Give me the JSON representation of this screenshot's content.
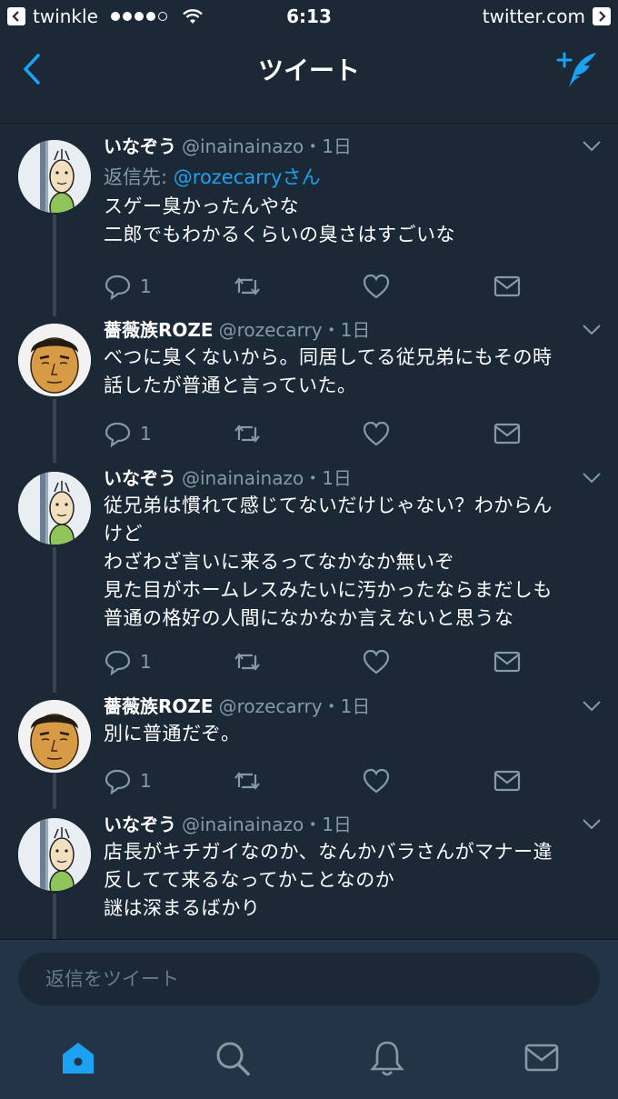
{
  "status_bar": {
    "back_app": "twinkle",
    "time": "6:13",
    "url": "twitter.com"
  },
  "nav": {
    "title": "ツイート"
  },
  "colors": {
    "accent": "#1da1f2",
    "background": "#1b2836",
    "muted": "#8899a6"
  },
  "tweets": [
    {
      "name": "いなぞう",
      "handle": "@inainainazo",
      "time": "・1日",
      "reply_prefix": "返信先: ",
      "reply_mention": "@rozecarryさん",
      "text": "スゲー臭かったんやな\n二郎でもわかるくらいの臭さはすごいな",
      "reply_count": "1",
      "avatar": "avatar-inainainazo"
    },
    {
      "name": "薔薇族ROZE",
      "handle": "@rozecarry",
      "time": "・1日",
      "text": "べつに臭くないから。同居してる従兄弟にもその時\n話したが普通と言っていた。",
      "reply_count": "1",
      "avatar": "avatar-rozecarry"
    },
    {
      "name": "いなぞう",
      "handle": "@inainainazo",
      "time": "・1日",
      "text": "従兄弟は慣れて感じてないだけじゃない？わからん\nけど\nわざわざ言いに来るってなかなか無いぞ\n見た目がホームレスみたいに汚かったならまだしも\n普通の格好の人間になかなか言えないと思うな",
      "reply_count": "1",
      "avatar": "avatar-inainainazo"
    },
    {
      "name": "薔薇族ROZE",
      "handle": "@rozecarry",
      "time": "・1日",
      "text": "別に普通だぞ。",
      "reply_count": "1",
      "avatar": "avatar-rozecarry"
    },
    {
      "name": "いなぞう",
      "handle": "@inainainazo",
      "time": "・1日",
      "text": "店長がキチガイなのか、なんかバラさんがマナー違\n反してて来るなってかことなのか\n謎は深まるばかり",
      "avatar": "avatar-inainainazo"
    }
  ],
  "composer": {
    "placeholder": "返信をツイート"
  },
  "tabs": [
    "home-icon",
    "search-icon",
    "notifications-icon",
    "messages-icon"
  ]
}
